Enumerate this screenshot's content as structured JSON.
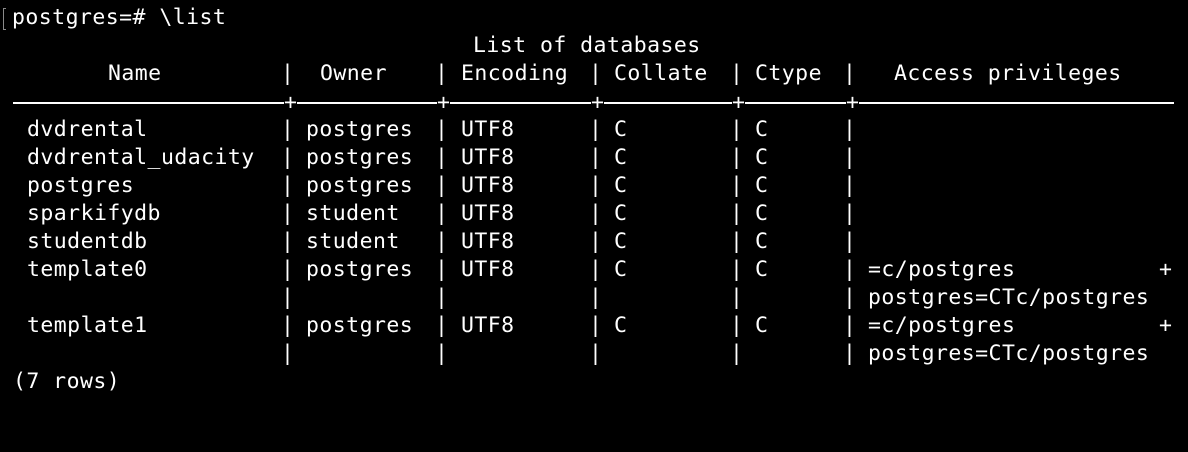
{
  "terminal": {
    "prompt": "postgres=# \\list",
    "title": "List of databases",
    "separator_plus": "+",
    "pipe": "|",
    "continuation": "+",
    "headers": [
      "Name",
      "Owner",
      "Encoding",
      "Collate",
      "Ctype",
      "Access privileges"
    ],
    "rows": [
      {
        "name": "dvdrental",
        "owner": "postgres",
        "encoding": "UTF8",
        "collate": "C",
        "ctype": "C",
        "access": ""
      },
      {
        "name": "dvdrental_udacity",
        "owner": "postgres",
        "encoding": "UTF8",
        "collate": "C",
        "ctype": "C",
        "access": ""
      },
      {
        "name": "postgres",
        "owner": "postgres",
        "encoding": "UTF8",
        "collate": "C",
        "ctype": "C",
        "access": ""
      },
      {
        "name": "sparkifydb",
        "owner": "student",
        "encoding": "UTF8",
        "collate": "C",
        "ctype": "C",
        "access": ""
      },
      {
        "name": "studentdb",
        "owner": "student",
        "encoding": "UTF8",
        "collate": "C",
        "ctype": "C",
        "access": ""
      },
      {
        "name": "template0",
        "owner": "postgres",
        "encoding": "UTF8",
        "collate": "C",
        "ctype": "C",
        "access": "=c/postgres"
      },
      {
        "name": "",
        "owner": "",
        "encoding": "",
        "collate": "",
        "ctype": "",
        "access": "postgres=CTc/postgres"
      },
      {
        "name": "template1",
        "owner": "postgres",
        "encoding": "UTF8",
        "collate": "C",
        "ctype": "C",
        "access": "=c/postgres"
      },
      {
        "name": "",
        "owner": "",
        "encoding": "",
        "collate": "",
        "ctype": "",
        "access": "postgres=CTc/postgres"
      }
    ],
    "footer": "(7 rows)"
  },
  "colors": {
    "background": "#000000",
    "text": "#ffffff"
  }
}
